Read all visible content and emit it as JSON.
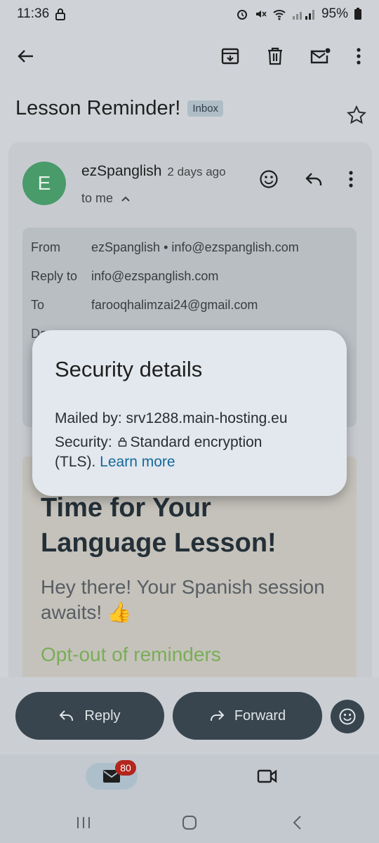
{
  "status_bar": {
    "time": "11:36",
    "battery": "95%"
  },
  "subject": {
    "title": "Lesson Reminder!",
    "label": "Inbox"
  },
  "sender": {
    "avatar_letter": "E",
    "name": "ezSpanglish",
    "time": "2 days ago",
    "to": "to me"
  },
  "details": {
    "from_label": "From",
    "from_value": "ezSpanglish • info@ezspanglish.com",
    "reply_label": "Reply to",
    "reply_value": "info@ezspanglish.com",
    "to_label": "To",
    "to_value": "farooqhalimzai24@gmail.com",
    "date_partial": "Da"
  },
  "email_body": {
    "title_line1": "Time for Your",
    "title_line2": "Language Lesson!",
    "greeting": "Hey there! Your Spanish session awaits! 👍",
    "opt_out": "Opt-out of reminders"
  },
  "security_dialog": {
    "title": "Security details",
    "mailed_by": "Mailed by: srv1288.main-hosting.eu",
    "security_prefix": "Security: ",
    "security_value": "Standard encryption",
    "tls": "(TLS). ",
    "learn_more": "Learn more"
  },
  "actions": {
    "reply": "Reply",
    "forward": "Forward"
  },
  "nav": {
    "mail_badge": "80"
  },
  "colors": {
    "accent": "#13699c",
    "avatar": "#4a9b6a",
    "pill": "#38454e",
    "badge": "#b3261e"
  }
}
